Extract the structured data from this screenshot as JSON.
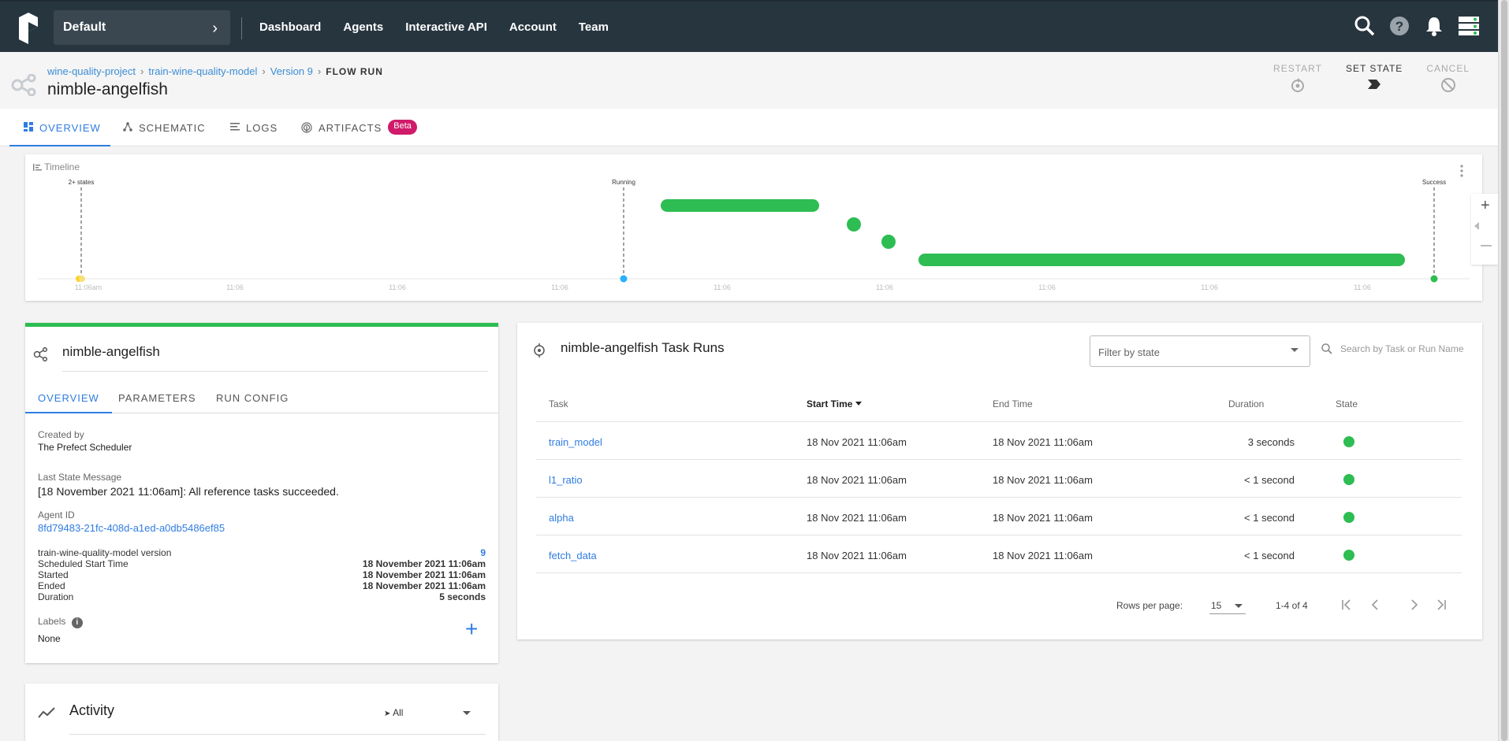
{
  "colors": {
    "topbar": "#27353f",
    "accent": "#2f7de1",
    "success": "#2dbd52",
    "running": "#27b1ff",
    "beta": "#d01a6a"
  },
  "topbar": {
    "team": "Default",
    "nav": [
      "Dashboard",
      "Agents",
      "Interactive API",
      "Account",
      "Team"
    ],
    "icons": [
      "search-icon",
      "help-icon",
      "bell-icon",
      "server-icon"
    ]
  },
  "breadcrumb": {
    "project": "wine-quality-project",
    "flow": "train-wine-quality-model",
    "version": "Version 9",
    "current": "FLOW RUN"
  },
  "run_name": "nimble-angelfish",
  "actions": {
    "restart": "RESTART",
    "set_state": "SET STATE",
    "cancel": "CANCEL"
  },
  "tabs": {
    "overview": "OVERVIEW",
    "schematic": "SCHEMATIC",
    "logs": "LOGS",
    "artifacts": "ARTIFACTS",
    "beta": "Beta"
  },
  "timeline": {
    "title": "Timeline",
    "markers": [
      "2+ states",
      "Running",
      "Success"
    ],
    "ticks": [
      "11:06am",
      "11:06",
      "11:06",
      "11:06",
      "11:06",
      "11:06",
      "11:06",
      "11:06",
      "11:06"
    ]
  },
  "flow_run_card": {
    "title": "nimble-angelfish",
    "tabs": [
      "OVERVIEW",
      "PARAMETERS",
      "RUN CONFIG"
    ],
    "created_by_label": "Created by",
    "created_by": "The Prefect Scheduler",
    "last_state_label": "Last State Message",
    "last_state": "[18 November 2021 11:06am]: All reference tasks succeeded.",
    "agent_label": "Agent ID",
    "agent_id": "8fd79483-21fc-408d-a1ed-a0db5486ef85",
    "details": [
      {
        "k": "train-wine-quality-model version",
        "v": "9"
      },
      {
        "k": "Scheduled Start Time",
        "v": "18 November 2021 11:06am"
      },
      {
        "k": "Started",
        "v": "18 November 2021 11:06am"
      },
      {
        "k": "Ended",
        "v": "18 November 2021 11:06am"
      },
      {
        "k": "Duration",
        "v": "5 seconds"
      }
    ],
    "labels_label": "Labels",
    "labels": "None"
  },
  "activity": {
    "title": "Activity",
    "filter": "All"
  },
  "task_runs": {
    "title": "nimble-angelfish Task Runs",
    "filter_placeholder": "Filter by state",
    "search_placeholder": "Search by Task or Run Name",
    "columns": {
      "task": "Task",
      "start": "Start Time",
      "end": "End Time",
      "duration": "Duration",
      "state": "State"
    },
    "rows": [
      {
        "task": "train_model",
        "start": "18 Nov 2021 11:06am",
        "end": "18 Nov 2021 11:06am",
        "duration": "3 seconds",
        "state": "Success"
      },
      {
        "task": "l1_ratio",
        "start": "18 Nov 2021 11:06am",
        "end": "18 Nov 2021 11:06am",
        "duration": "< 1 second",
        "state": "Success"
      },
      {
        "task": "alpha",
        "start": "18 Nov 2021 11:06am",
        "end": "18 Nov 2021 11:06am",
        "duration": "< 1 second",
        "state": "Success"
      },
      {
        "task": "fetch_data",
        "start": "18 Nov 2021 11:06am",
        "end": "18 Nov 2021 11:06am",
        "duration": "< 1 second",
        "state": "Success"
      }
    ],
    "rows_per_page_label": "Rows per page:",
    "rows_per_page": "15",
    "range": "1-4 of 4"
  }
}
